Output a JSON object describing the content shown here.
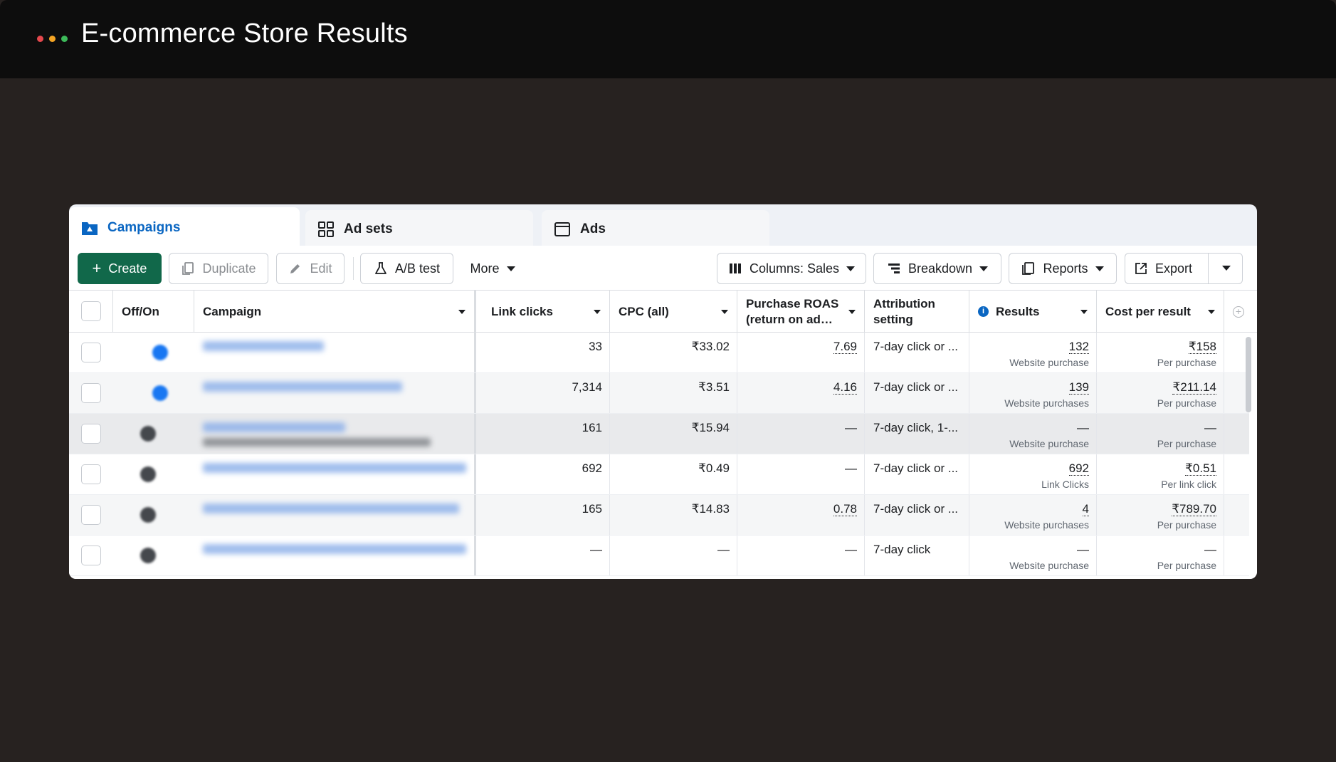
{
  "window": {
    "title": "E-commerce Store Results",
    "dot_colors": [
      "#e5484d",
      "#f5a524",
      "#3dba5a"
    ]
  },
  "tabs": [
    {
      "label": "Campaigns",
      "icon": "folder-icon",
      "active": true
    },
    {
      "label": "Ad sets",
      "icon": "grid-icon",
      "active": false
    },
    {
      "label": "Ads",
      "icon": "window-icon",
      "active": false
    }
  ],
  "toolbar": {
    "create": "Create",
    "duplicate": "Duplicate",
    "edit": "Edit",
    "ab_test": "A/B test",
    "more": "More",
    "columns": "Columns: Sales",
    "breakdown": "Breakdown",
    "reports": "Reports",
    "export": "Export"
  },
  "table": {
    "headers": {
      "off_on": "Off/On",
      "campaign": "Campaign",
      "link_clicks": "Link clicks",
      "cpc": "CPC (all)",
      "roas_line1": "Purchase ROAS",
      "roas_line2": "(return on ad…",
      "attr_line1": "Attribution",
      "attr_line2": "setting",
      "results": "Results",
      "cost_per_result": "Cost per result"
    },
    "rows": [
      {
        "status": "on",
        "link_clicks": "33",
        "cpc": "₹33.02",
        "roas": "7.69",
        "attribution": "7-day click or ...",
        "results": "132",
        "results_label": "Website purchase",
        "cost": "₹158",
        "cost_label": "Per purchase",
        "bg": "#ffffff"
      },
      {
        "status": "on",
        "link_clicks": "7,314",
        "cpc": "₹3.51",
        "roas": "4.16",
        "attribution": "7-day click or ...",
        "results": "139",
        "results_label": "Website purchases",
        "cost": "₹211.14",
        "cost_label": "Per purchase",
        "bg": "#f5f6f7"
      },
      {
        "status": "off",
        "link_clicks": "161",
        "cpc": "₹15.94",
        "roas": "—",
        "attribution": "7-day click, 1-...",
        "results": "—",
        "results_label": "Website purchase",
        "cost": "—",
        "cost_label": "Per purchase",
        "bg": "#e9eaec"
      },
      {
        "status": "off",
        "link_clicks": "692",
        "cpc": "₹0.49",
        "roas": "—",
        "attribution": "7-day click or ...",
        "results": "692",
        "results_label": "Link Clicks",
        "cost": "₹0.51",
        "cost_label": "Per link click",
        "bg": "#ffffff"
      },
      {
        "status": "off",
        "link_clicks": "165",
        "cpc": "₹14.83",
        "roas": "0.78",
        "attribution": "7-day click or ...",
        "results": "4",
        "results_label": "Website purchases",
        "cost": "₹789.70",
        "cost_label": "Per purchase",
        "bg": "#f5f6f7"
      },
      {
        "status": "off",
        "link_clicks": "—",
        "cpc": "—",
        "roas": "—",
        "attribution": "7-day click",
        "results": "—",
        "results_label": "Website purchase",
        "cost": "—",
        "cost_label": "Per purchase",
        "bg": "#ffffff"
      }
    ]
  },
  "colors": {
    "accent": "#0a66c2",
    "create_button": "#11684a",
    "toggle_on": "#1877f2",
    "toggle_off": "#45484d"
  }
}
